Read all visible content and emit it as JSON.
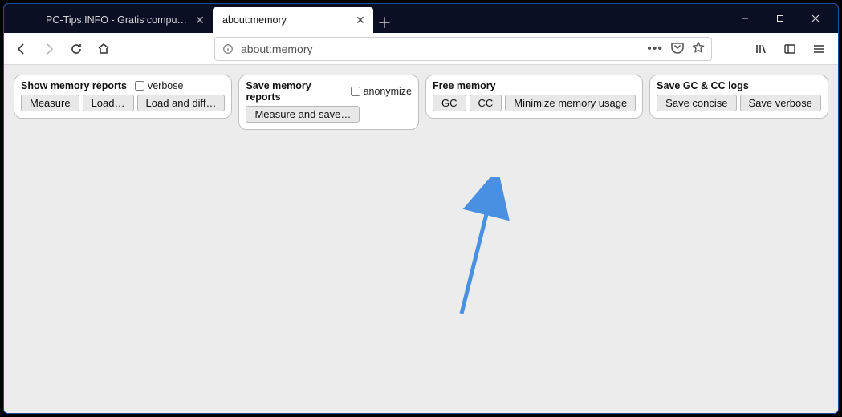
{
  "tabs": [
    {
      "label": "PC-Tips.INFO - Gratis computer tips",
      "active": false
    },
    {
      "label": "about:memory",
      "active": true
    }
  ],
  "url": "about:memory",
  "panels": {
    "show": {
      "title": "Show memory reports",
      "checkbox": "verbose",
      "buttons": [
        "Measure",
        "Load…",
        "Load and diff…"
      ]
    },
    "save": {
      "title": "Save memory reports",
      "checkbox": "anonymize",
      "buttons": [
        "Measure and save…"
      ]
    },
    "free": {
      "title": "Free memory",
      "buttons": [
        "GC",
        "CC",
        "Minimize memory usage"
      ]
    },
    "logs": {
      "title": "Save GC & CC logs",
      "buttons": [
        "Save concise",
        "Save verbose"
      ]
    }
  }
}
